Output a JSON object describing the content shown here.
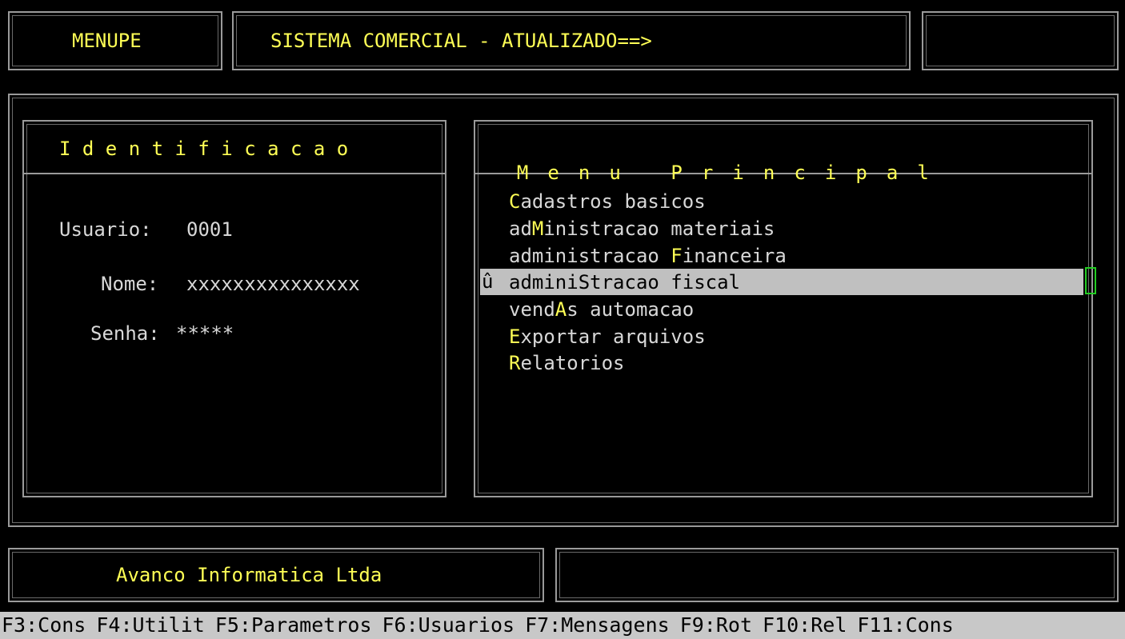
{
  "header": {
    "program_name": "MENUPE",
    "system_title": "SISTEMA COMERCIAL - ATUALIZADO==>",
    "right_box": ""
  },
  "identification": {
    "title": "I d e n t i f i c a c a o",
    "usuario_label": "Usuario:",
    "usuario_value": "0001",
    "nome_label": "Nome:",
    "nome_value": "xxxxxxxxxxxxxxx",
    "senha_label": "Senha:",
    "senha_value": "*****"
  },
  "main_menu": {
    "title": "M e n u   P r i n c i p a l",
    "selected_marker": "û",
    "items": [
      {
        "pre": "",
        "hot": "C",
        "post": "adastros basicos",
        "selected": false
      },
      {
        "pre": "ad",
        "hot": "M",
        "post": "inistracao materiais",
        "selected": false
      },
      {
        "pre": "administracao ",
        "hot": "F",
        "post": "inanceira",
        "selected": false
      },
      {
        "pre": "admini",
        "hot": "S",
        "post": "tracao fiscal",
        "selected": true
      },
      {
        "pre": "vend",
        "hot": "A",
        "post": "s automacao",
        "selected": false
      },
      {
        "pre": "",
        "hot": "E",
        "post": "xportar arquivos",
        "selected": false
      },
      {
        "pre": "",
        "hot": "R",
        "post": "elatorios",
        "selected": false
      }
    ]
  },
  "footer": {
    "company": "Avanco Informatica Ltda",
    "status": ""
  },
  "function_keys": [
    "F3:Cons",
    "F4:Utilit",
    "F5:Parametros",
    "F6:Usuarios",
    "F7:Mensagens",
    "F9:Rot",
    "F10:Rel",
    "F11:Cons"
  ],
  "colors": {
    "background": "#000000",
    "highlight_text": "#ffff55",
    "normal_text": "#d8d8d8",
    "selection_bg": "#c0c0c0",
    "cursor": "#22cc22"
  }
}
